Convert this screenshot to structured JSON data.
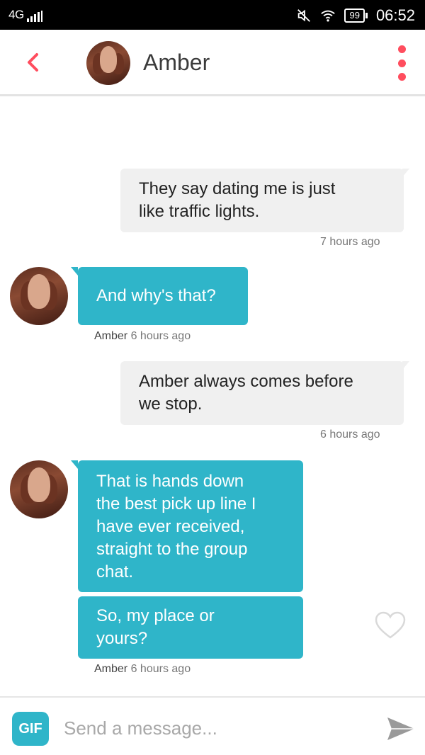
{
  "status_bar": {
    "network": "4G",
    "battery": "99",
    "time": "06:52"
  },
  "header": {
    "contact_name": "Amber"
  },
  "messages": [
    {
      "text_lines": [
        "They say dating me is just",
        "like traffic lights."
      ],
      "direction": "outgoing",
      "meta": "7 hours ago"
    },
    {
      "text_lines": [
        "And why's that?"
      ],
      "direction": "incoming",
      "sender": "Amber",
      "meta": "6 hours ago"
    },
    {
      "text_lines": [
        "Amber always comes before",
        "we stop."
      ],
      "direction": "outgoing",
      "meta": "6 hours ago"
    },
    {
      "text_lines": [
        "That is hands down",
        "the best pick up line I",
        "have ever received,",
        "straight to the group",
        "chat."
      ],
      "direction": "incoming"
    },
    {
      "text_lines": [
        "So, my place or",
        "yours?"
      ],
      "direction": "incoming",
      "sender": "Amber",
      "meta": "6 hours ago"
    }
  ],
  "composer": {
    "gif_label": "GIF",
    "placeholder": "Send a message..."
  },
  "colors": {
    "accent": "#ff4d5e",
    "incoming_bubble": "#2fb5c9",
    "outgoing_bubble": "#f0f0f0"
  },
  "icons": [
    "back-chevron-icon",
    "more-menu-icon",
    "heart-icon",
    "send-icon",
    "wifi-icon",
    "mute-icon"
  ]
}
